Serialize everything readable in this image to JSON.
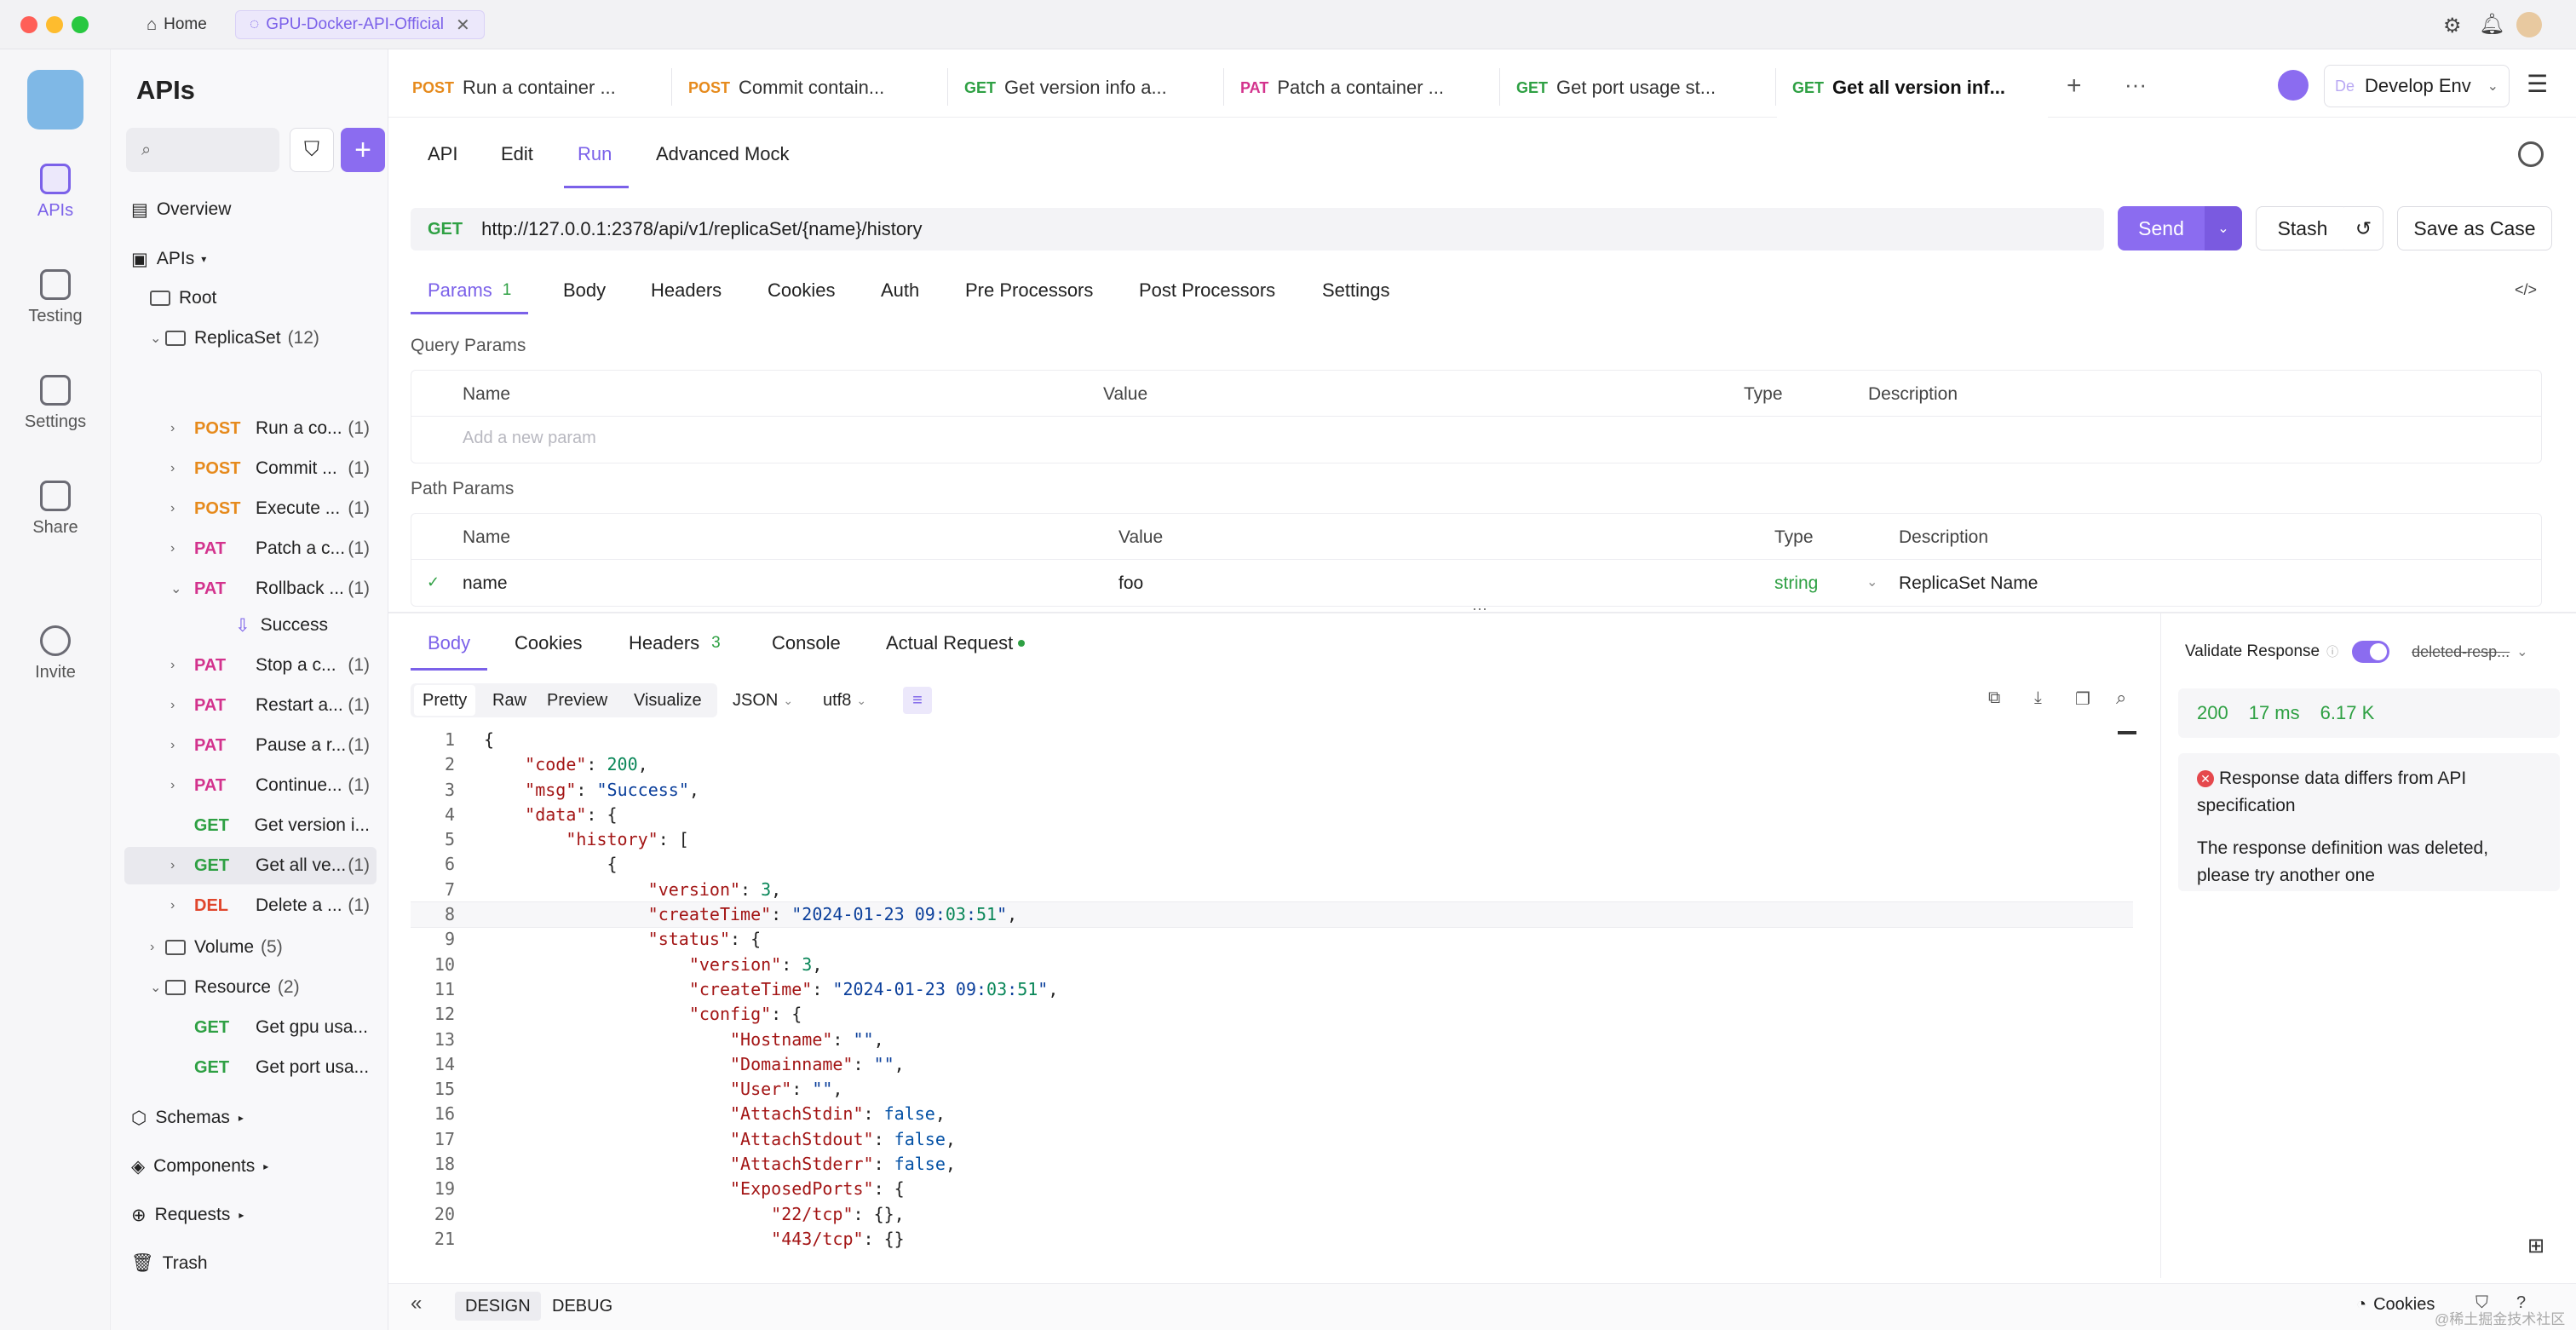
{
  "titlebar": {
    "home_label": "Home",
    "project_tab": "GPU-Docker-API-Official"
  },
  "rail": {
    "items": [
      {
        "label": "APIs"
      },
      {
        "label": "Testing"
      },
      {
        "label": "Settings"
      },
      {
        "label": "Share"
      },
      {
        "label": "Invite"
      }
    ]
  },
  "tree": {
    "title": "APIs",
    "overview": "Overview",
    "apis": "APIs",
    "root": "Root",
    "replicaset": {
      "name": "ReplicaSet",
      "count": "(12)"
    },
    "items": [
      {
        "method": "POST",
        "name": "Run a co...",
        "count": "(1)"
      },
      {
        "method": "POST",
        "name": "Commit ...",
        "count": "(1)"
      },
      {
        "method": "POST",
        "name": "Execute ...",
        "count": "(1)"
      },
      {
        "method": "PAT",
        "name": "Patch a c...",
        "count": "(1)"
      },
      {
        "method": "PAT",
        "name": "Rollback ...",
        "count": "(1)"
      },
      {
        "method": "PAT",
        "name": "Stop a c...",
        "count": "(1)"
      },
      {
        "method": "PAT",
        "name": "Restart a...",
        "count": "(1)"
      },
      {
        "method": "PAT",
        "name": "Pause a r...",
        "count": "(1)"
      },
      {
        "method": "PAT",
        "name": "Continue...",
        "count": "(1)"
      },
      {
        "method": "GET",
        "name": "Get version i...",
        "count": ""
      },
      {
        "method": "GET",
        "name": "Get all ve...",
        "count": "(1)"
      },
      {
        "method": "DEL",
        "name": "Delete a ...",
        "count": "(1)"
      }
    ],
    "success": "Success",
    "volume": {
      "name": "Volume",
      "count": "(5)"
    },
    "resource": {
      "name": "Resource",
      "count": "(2)"
    },
    "resource_items": [
      {
        "method": "GET",
        "name": "Get gpu usa..."
      },
      {
        "method": "GET",
        "name": "Get port usa..."
      }
    ],
    "schemas": "Schemas",
    "components": "Components",
    "requests": "Requests",
    "trash": "Trash"
  },
  "tabs": [
    {
      "method": "POST",
      "label": "Run a container ..."
    },
    {
      "method": "POST",
      "label": "Commit contain..."
    },
    {
      "method": "GET",
      "label": "Get version info a..."
    },
    {
      "method": "PAT",
      "label": "Patch a container ..."
    },
    {
      "method": "GET",
      "label": "Get port usage st..."
    },
    {
      "method": "GET",
      "label": "Get all version inf..."
    }
  ],
  "env": {
    "badge": "De",
    "label": "Develop Env"
  },
  "subtabs": [
    "API",
    "Edit",
    "Run",
    "Advanced Mock"
  ],
  "url": {
    "method": "GET",
    "value": "http://127.0.0.1:2378/api/v1/replicaSet/{name}/history"
  },
  "buttons": {
    "send": "Send",
    "stash": "Stash",
    "save_case": "Save as Case"
  },
  "param_tabs": {
    "params": "Params",
    "params_count": "1",
    "items": [
      "Body",
      "Headers",
      "Cookies",
      "Auth",
      "Pre Processors",
      "Post Processors",
      "Settings"
    ]
  },
  "query": {
    "label": "Query Params",
    "cols": [
      "Name",
      "Value",
      "Type",
      "Description"
    ],
    "placeholder": "Add a new param"
  },
  "path": {
    "label": "Path Params",
    "cols": [
      "Name",
      "Value",
      "Type",
      "Description"
    ],
    "row": {
      "name": "name",
      "value": "foo",
      "type": "string",
      "desc": "ReplicaSet Name"
    }
  },
  "resp_tabs": {
    "body": "Body",
    "cookies": "Cookies",
    "headers": "Headers",
    "headers_count": "3",
    "console": "Console",
    "actual": "Actual Request"
  },
  "format": {
    "pretty": "Pretty",
    "raw": "Raw",
    "preview": "Preview",
    "visualize": "Visualize",
    "lang": "JSON",
    "enc": "utf8"
  },
  "code_lines": [
    {
      "n": "1",
      "t": "{"
    },
    {
      "n": "2",
      "t": "    \"code\": 200,"
    },
    {
      "n": "3",
      "t": "    \"msg\": \"Success\","
    },
    {
      "n": "4",
      "t": "    \"data\": {"
    },
    {
      "n": "5",
      "t": "        \"history\": ["
    },
    {
      "n": "6",
      "t": "            {"
    },
    {
      "n": "7",
      "t": "                \"version\": 3,"
    },
    {
      "n": "8",
      "t": "                \"createTime\": \"2024-01-23 09:03:51\","
    },
    {
      "n": "9",
      "t": "                \"status\": {"
    },
    {
      "n": "10",
      "t": "                    \"version\": 3,"
    },
    {
      "n": "11",
      "t": "                    \"createTime\": \"2024-01-23 09:03:51\","
    },
    {
      "n": "12",
      "t": "                    \"config\": {"
    },
    {
      "n": "13",
      "t": "                        \"Hostname\": \"\","
    },
    {
      "n": "14",
      "t": "                        \"Domainname\": \"\","
    },
    {
      "n": "15",
      "t": "                        \"User\": \"\","
    },
    {
      "n": "16",
      "t": "                        \"AttachStdin\": false,"
    },
    {
      "n": "17",
      "t": "                        \"AttachStdout\": false,"
    },
    {
      "n": "18",
      "t": "                        \"AttachStderr\": false,"
    },
    {
      "n": "19",
      "t": "                        \"ExposedPorts\": {"
    },
    {
      "n": "20",
      "t": "                            \"22/tcp\": {},"
    },
    {
      "n": "21",
      "t": "                            \"443/tcp\": {}"
    }
  ],
  "validate": {
    "label": "Validate Response",
    "schema": "deleted-resp...",
    "status": "200",
    "time": "17 ms",
    "size": "6.17 K",
    "error_title": "Response data differs from API specification",
    "error_body": "The response definition was deleted, please try another one"
  },
  "bottom": {
    "design": "DESIGN",
    "debug": "DEBUG",
    "cookies": "Cookies",
    "watermark": "@稀土掘金技术社区"
  },
  "colors": {
    "accent": "#7b61e9",
    "post": "#e68a1c",
    "get": "#2ea043",
    "patch": "#d3338d",
    "delete": "#e0462c"
  }
}
